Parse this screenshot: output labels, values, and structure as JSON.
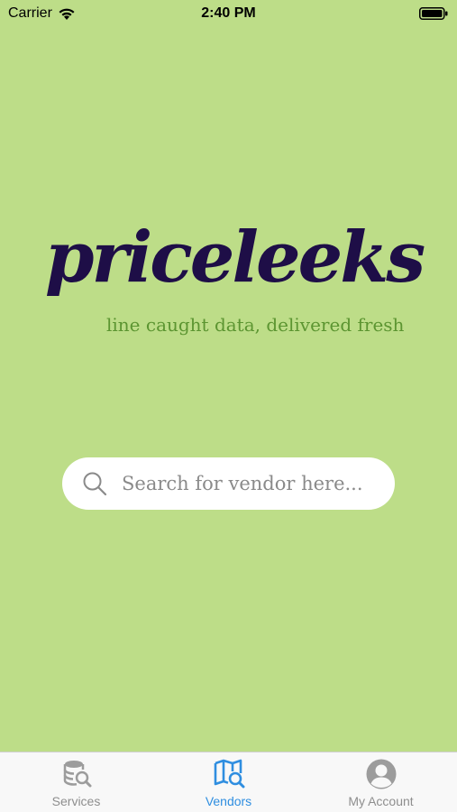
{
  "status_bar": {
    "carrier": "Carrier",
    "time": "2:40 PM"
  },
  "brand": {
    "logo_text": "priceleeks",
    "tagline": "line caught data, delivered fresh"
  },
  "search": {
    "placeholder": "Search for vendor here..."
  },
  "tabs": [
    {
      "label": "Services",
      "icon": "database-search-icon",
      "active": false
    },
    {
      "label": "Vendors",
      "icon": "map-search-icon",
      "active": true
    },
    {
      "label": "My Account",
      "icon": "user-circle-icon",
      "active": false
    }
  ],
  "colors": {
    "background": "#bddd88",
    "logo": "#1e0e47",
    "tagline": "#5c9531",
    "tab_active": "#2f8ee0",
    "tab_inactive": "#8e8e8e"
  }
}
